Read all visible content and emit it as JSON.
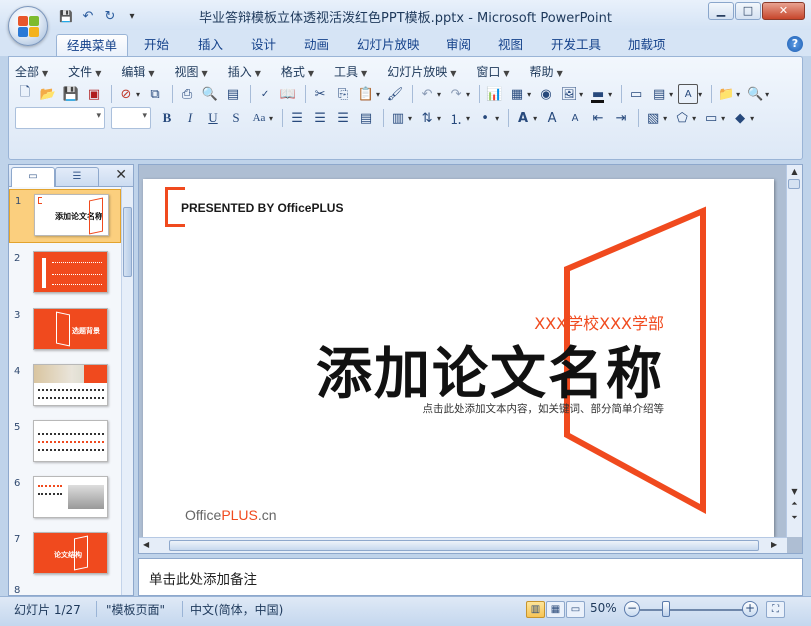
{
  "window": {
    "title": "毕业答辩模板立体透视活泼红色PPT模板.pptx - Microsoft PowerPoint",
    "minimize": "▁",
    "maximize": "□",
    "close": "✕"
  },
  "quick_access": {
    "save": "💾",
    "undo": "↶",
    "redo": "↻",
    "customize": "▾"
  },
  "ribbon_tabs": [
    "经典菜单",
    "开始",
    "插入",
    "设计",
    "动画",
    "幻灯片放映",
    "审阅",
    "视图",
    "开发工具",
    "加载项"
  ],
  "help": "?",
  "classic_menu": [
    "全部",
    "文件",
    "编辑",
    "视图",
    "插入",
    "格式",
    "工具",
    "幻灯片放映",
    "窗口",
    "帮助"
  ],
  "format_buttons": {
    "bold": "B",
    "italic": "I",
    "underline": "U",
    "shadow": "S",
    "case": "Aa"
  },
  "left_pane": {
    "close": "✕",
    "slides": [
      {
        "num": "1",
        "label": "添加论文名称",
        "style": "title"
      },
      {
        "num": "2",
        "label": "",
        "style": "red"
      },
      {
        "num": "3",
        "label": "选题背景",
        "style": "red-frame"
      },
      {
        "num": "4",
        "label": "",
        "style": "photo"
      },
      {
        "num": "5",
        "label": "",
        "style": "white"
      },
      {
        "num": "6",
        "label": "",
        "style": "white2"
      },
      {
        "num": "7",
        "label": "论文结构",
        "style": "red-frame"
      }
    ]
  },
  "slide": {
    "presented_by": "PRESENTED BY OfficePLUS",
    "school": "XXX学校XXX学部",
    "title": "添加论文名称",
    "subtitle": "点击此处添加文本内容，如关键词、部分简单介绍等",
    "logo_office": "Office",
    "logo_plus": "PLUS",
    "logo_cn": ".cn",
    "accent_color": "#f04a1e"
  },
  "notes": {
    "placeholder": "单击此处添加备注"
  },
  "status": {
    "slide_info": "幻灯片 1/27",
    "theme": "\"模板页面\"",
    "language": "中文(简体，中国)",
    "zoom": "50%",
    "zoom_fraction": 0.5
  }
}
